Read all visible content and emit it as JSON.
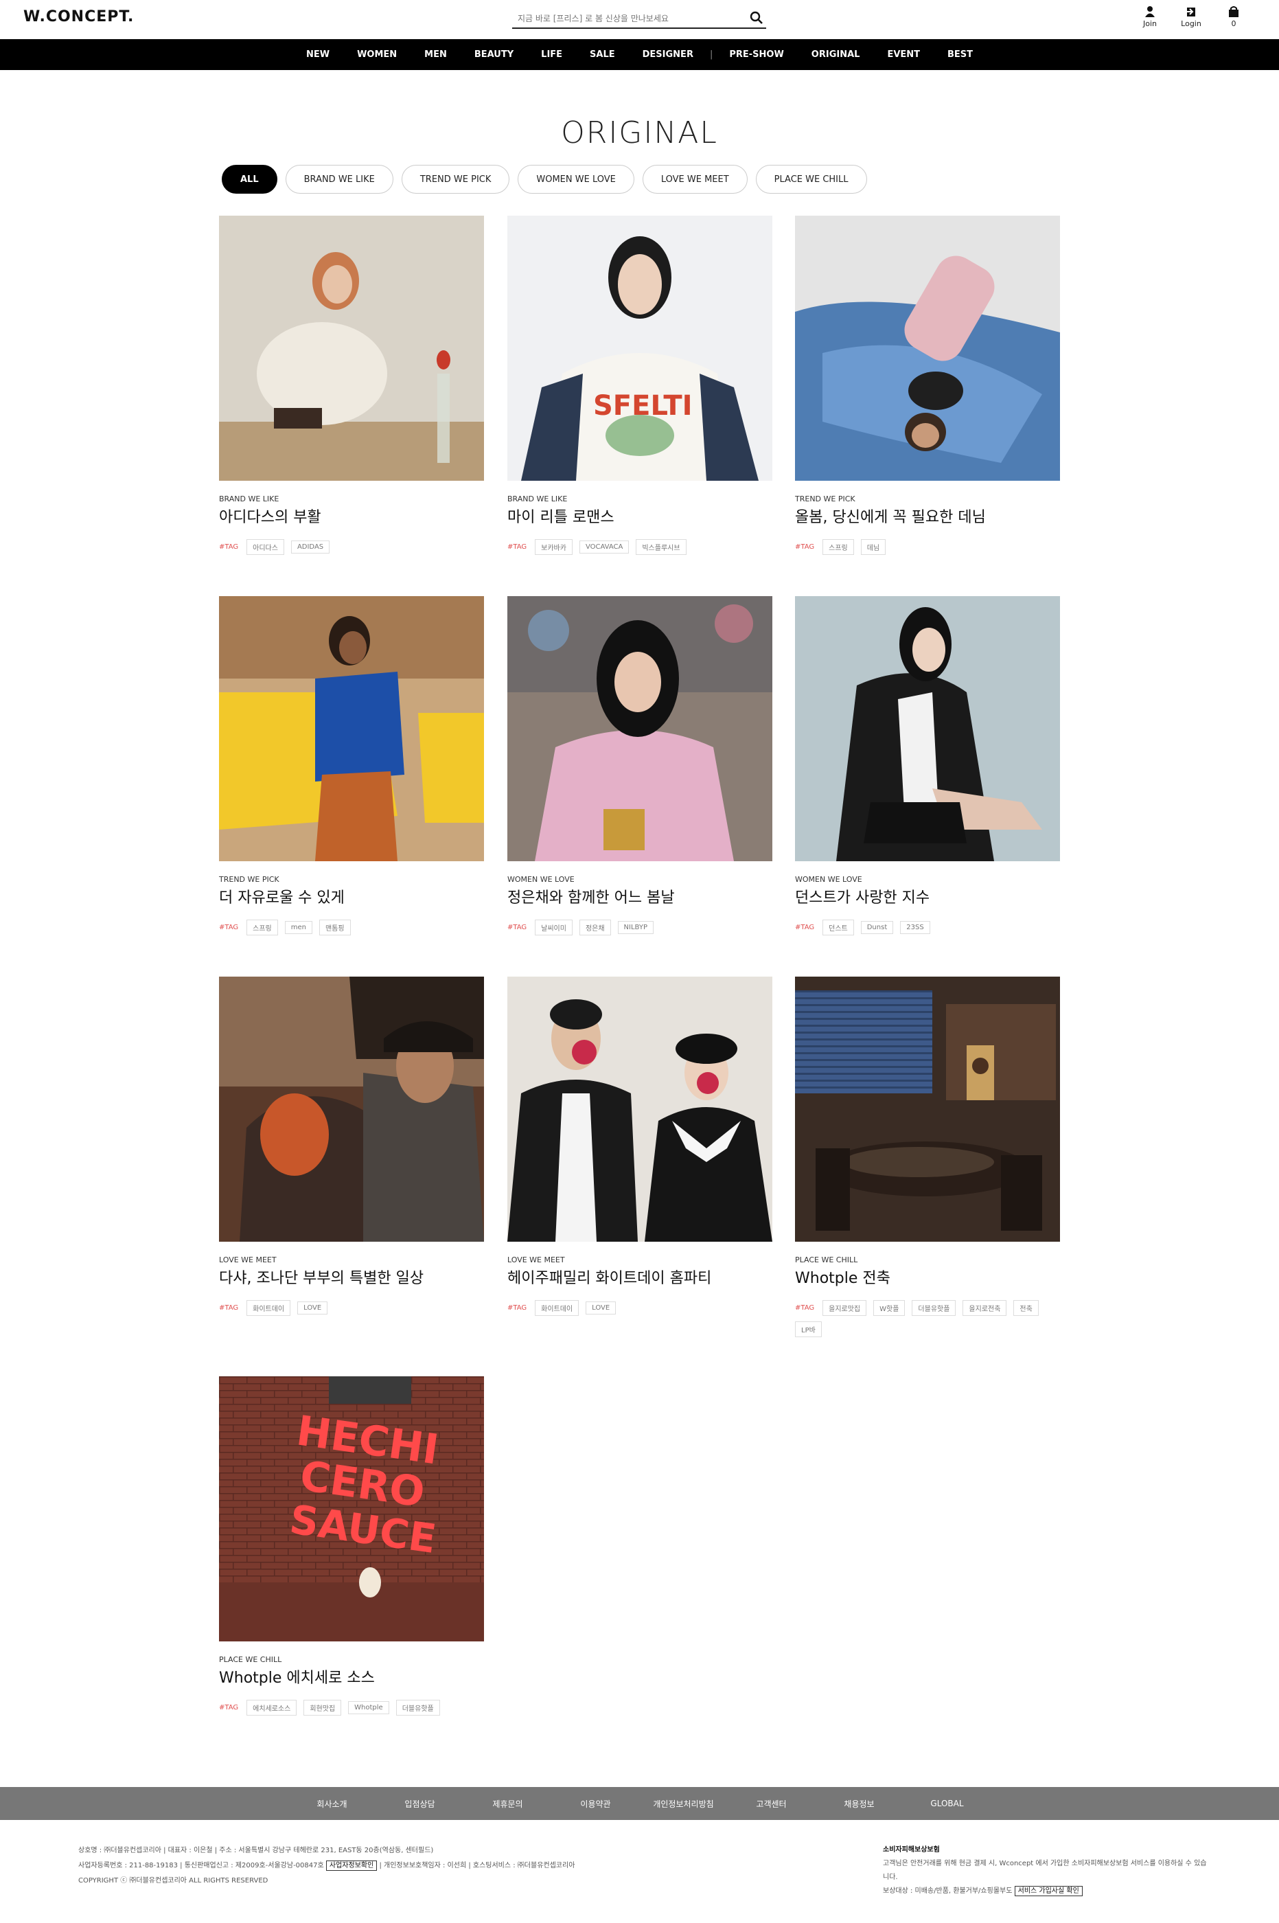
{
  "header": {
    "logo": "W.CONCEPT.",
    "search_placeholder": "지금 바로 [프리스] 로 봄 신상을 만나보세요",
    "join_label": "Join",
    "login_label": "Login",
    "cart_count": "0"
  },
  "gnb": {
    "items": [
      "NEW",
      "WOMEN",
      "MEN",
      "BEAUTY",
      "LIFE",
      "SALE",
      "DESIGNER",
      "PRE-SHOW",
      "ORIGINAL",
      "EVENT",
      "BEST"
    ]
  },
  "page_title": "ORIGINAL",
  "filters": [
    "ALL",
    "BRAND WE LIKE",
    "TREND WE PICK",
    "WOMEN WE LOVE",
    "LOVE WE MEET",
    "PLACE WE CHILL"
  ],
  "tag_label": "#TAG",
  "cards": [
    {
      "category": "BRAND WE LIKE",
      "title": "아디다스의 부활",
      "tags": [
        "아디다스",
        "ADIDAS"
      ]
    },
    {
      "category": "BRAND WE LIKE",
      "title": "마이 리틀 로맨스",
      "tags": [
        "보카바카",
        "VOCAVACA",
        "빅스플루시브"
      ]
    },
    {
      "category": "TREND WE PICK",
      "title": "올봄, 당신에게 꼭 필요한 데님",
      "tags": [
        "스프링",
        "데님"
      ]
    },
    {
      "category": "TREND WE PICK",
      "title": "더 자유로울 수 있게",
      "tags": [
        "스프링",
        "men",
        "맨톰핑"
      ]
    },
    {
      "category": "WOMEN WE LOVE",
      "title": "정은채와 함께한 어느 봄날",
      "tags": [
        "날씨이미",
        "정은채",
        "NILBYP"
      ]
    },
    {
      "category": "WOMEN WE LOVE",
      "title": "던스트가 사랑한 지수",
      "tags": [
        "던스트",
        "Dunst",
        "23SS"
      ]
    },
    {
      "category": "LOVE WE MEET",
      "title": "다샤, 조나단 부부의 특별한 일상",
      "tags": [
        "화이트데이",
        "LOVE"
      ]
    },
    {
      "category": "LOVE WE MEET",
      "title": "헤이주패밀리 화이트데이 홈파티",
      "tags": [
        "화이트데이",
        "LOVE"
      ]
    },
    {
      "category": "PLACE WE CHILL",
      "title": "Whotple 전축",
      "tags": [
        "을지로맛집",
        "W핫플",
        "더블유핫플",
        "을지로전축",
        "전축",
        "LP바"
      ]
    },
    {
      "category": "PLACE WE CHILL",
      "title": "Whotple 에치세로 소스",
      "tags": [
        "에치세로소스",
        "회현맛집",
        "Whotple",
        "더블유핫플"
      ]
    }
  ],
  "sign_text": [
    "HECHI",
    "CERO",
    "SAUCE"
  ],
  "footer": {
    "links": [
      "회사소개",
      "입점상담",
      "제휴문의",
      "이용약관",
      "개인정보처리방침",
      "고객센터",
      "채용정보",
      "GLOBAL"
    ],
    "line1": "상호명 : ㈜더블유컨셉코리아  |  대표자 : 이은철  |  주소 : 서울특별시 강남구 테헤란로 231, EAST동 20층(역삼동, 센터필드)",
    "line2a": "사업자등록번호 : 211-88-19183  |  통신판매업신고 : 제2009호-서울강남-00847호",
    "line2_box": "사업자정보확인",
    "line2b": "|  개인정보보호책임자 : 이선희  |  호스팅서비스 : ㈜더블유컨셉코리아",
    "line3": "COPYRIGHT ⓒ ㈜더블유컨셉코리아 ALL RIGHTS RESERVED",
    "right_title": "소비자피해보상보험",
    "right_line1": "고객님은 안전거래를 위해 현금 결제 시, Wconcept 에서 가입한 소비자피해보상보험 서비스를 이용하실 수 있습니다.",
    "right_line2": "보상대상 : 미배송/반품, 환불거부/쇼핑몰부도",
    "right_box": "서비스 가입사실 확인"
  }
}
